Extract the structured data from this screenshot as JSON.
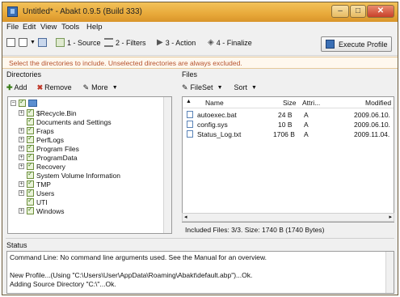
{
  "window": {
    "title": "Untitled* - Abakt 0.9.5 (Build 333)",
    "minimize_glyph": "–",
    "maximize_glyph": "□",
    "close_glyph": "✕"
  },
  "menu": [
    {
      "label": "File"
    },
    {
      "label": "Edit"
    },
    {
      "label": "View"
    },
    {
      "label": "Tools"
    },
    {
      "label": "Help"
    }
  ],
  "toolbar": {
    "source": "1 - Source",
    "filters": "2 - Filters",
    "action": "3 - Action",
    "finalize": "4 - Finalize",
    "execute": "Execute Profile"
  },
  "info_message": "Select the directories to include. Unselected directories are always excluded.",
  "directories": {
    "label": "Directories",
    "add": "Add",
    "remove": "Remove",
    "more": "More",
    "items": [
      {
        "label": "$Recycle.Bin"
      },
      {
        "label": "Documents and Settings"
      },
      {
        "label": "Fraps"
      },
      {
        "label": "PerfLogs"
      },
      {
        "label": "Program Files"
      },
      {
        "label": "ProgramData"
      },
      {
        "label": "Recovery"
      },
      {
        "label": "System Volume Information"
      },
      {
        "label": "TMP"
      },
      {
        "label": "Users"
      },
      {
        "label": "UTI"
      },
      {
        "label": "Windows"
      }
    ]
  },
  "files": {
    "label": "Files",
    "fileset": "FileSet",
    "sort": "Sort",
    "columns": {
      "name": "Name",
      "size": "Size",
      "attr": "Attri...",
      "modified": "Modified"
    },
    "rows": [
      {
        "name": "autoexec.bat",
        "size": "24 B",
        "attr": "A",
        "modified": "2009.06.10."
      },
      {
        "name": "config.sys",
        "size": "10 B",
        "attr": "A",
        "modified": "2009.06.10."
      },
      {
        "name": "Status_Log.txt",
        "size": "1706 B",
        "attr": "A",
        "modified": "2009.11.04."
      }
    ],
    "summary": "Included Files: 3/3. Size: 1740 B (1740 Bytes)"
  },
  "status": {
    "label": "Status",
    "lines": [
      "Command Line: No command line arguments used. See the Manual for an overview.",
      "",
      "New Profile...(Using \"C:\\Users\\User\\AppData\\Roaming\\Abakt\\default.abp\")...Ok.",
      "Adding Source Directory \"C:\\\"...Ok."
    ]
  }
}
